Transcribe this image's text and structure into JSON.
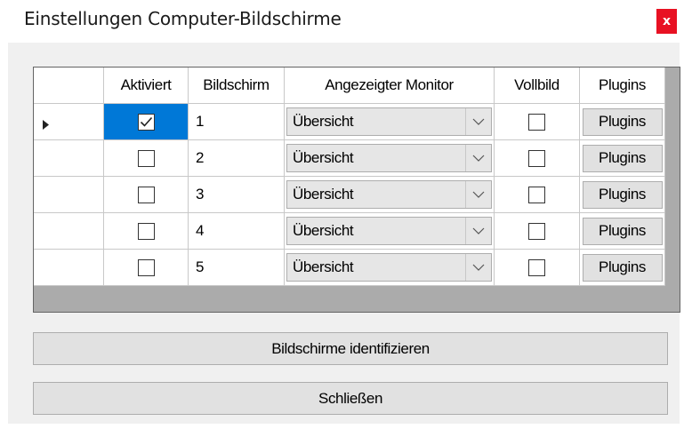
{
  "window": {
    "title": "Einstellungen Computer-Bildschirme",
    "close_glyph": "x",
    "close_color": "#e81123"
  },
  "grid": {
    "columns": [
      "Aktiviert",
      "Bildschirm",
      "Angezeigter Monitor",
      "Vollbild",
      "Plugins"
    ],
    "selected_row": 0,
    "selection_color": "#0078d7",
    "rows": [
      {
        "aktiviert": true,
        "bildschirm": "1",
        "monitor": "Übersicht",
        "vollbild": false,
        "plugins": "Plugins"
      },
      {
        "aktiviert": false,
        "bildschirm": "2",
        "monitor": "Übersicht",
        "vollbild": false,
        "plugins": "Plugins"
      },
      {
        "aktiviert": false,
        "bildschirm": "3",
        "monitor": "Übersicht",
        "vollbild": false,
        "plugins": "Plugins"
      },
      {
        "aktiviert": false,
        "bildschirm": "4",
        "monitor": "Übersicht",
        "vollbild": false,
        "plugins": "Plugins"
      },
      {
        "aktiviert": false,
        "bildschirm": "5",
        "monitor": "Übersicht",
        "vollbild": false,
        "plugins": "Plugins"
      }
    ]
  },
  "buttons": {
    "identify": "Bildschirme identifizieren",
    "close": "Schließen"
  },
  "icons": {
    "row_indicator": "triangle-right-icon",
    "dropdown": "chevron-down-icon",
    "check": "checkmark-icon"
  }
}
